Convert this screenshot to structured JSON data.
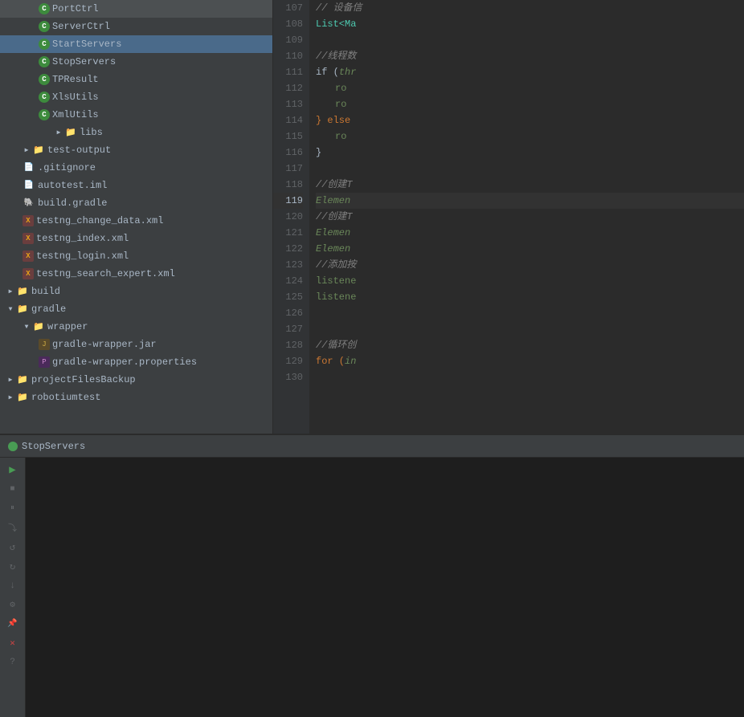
{
  "fileTree": {
    "items": [
      {
        "id": "portctrl",
        "label": "PortCtrl",
        "type": "class",
        "indent": 2,
        "selected": false
      },
      {
        "id": "serverctrl",
        "label": "ServerCtrl",
        "type": "class",
        "indent": 2,
        "selected": false
      },
      {
        "id": "startservers",
        "label": "StartServers",
        "type": "class",
        "indent": 2,
        "selected": true
      },
      {
        "id": "stopservers",
        "label": "StopServers",
        "type": "class",
        "indent": 2,
        "selected": false
      },
      {
        "id": "tpresult",
        "label": "TPResult",
        "type": "class",
        "indent": 2,
        "selected": false
      },
      {
        "id": "xlsutils",
        "label": "XlsUtils",
        "type": "class",
        "indent": 2,
        "selected": false
      },
      {
        "id": "xmlutils",
        "label": "XmlUtils",
        "type": "class",
        "indent": 2,
        "selected": false
      },
      {
        "id": "libs",
        "label": "libs",
        "type": "folder",
        "indent": 3,
        "arrow": "▶",
        "selected": false
      },
      {
        "id": "test-output",
        "label": "test-output",
        "type": "folder",
        "indent": 1,
        "arrow": "▶",
        "selected": false
      },
      {
        "id": "gitignore",
        "label": ".gitignore",
        "type": "file",
        "indent": 1,
        "selected": false
      },
      {
        "id": "autotest-iml",
        "label": "autotest.iml",
        "type": "file",
        "indent": 1,
        "selected": false
      },
      {
        "id": "build-gradle",
        "label": "build.gradle",
        "type": "gradle",
        "indent": 1,
        "selected": false
      },
      {
        "id": "testng-change",
        "label": "testng_change_data.xml",
        "type": "xml",
        "indent": 1,
        "selected": false
      },
      {
        "id": "testng-index",
        "label": "testng_index.xml",
        "type": "xml",
        "indent": 1,
        "selected": false
      },
      {
        "id": "testng-login",
        "label": "testng_login.xml",
        "type": "xml",
        "indent": 1,
        "selected": false
      },
      {
        "id": "testng-search",
        "label": "testng_search_expert.xml",
        "type": "xml",
        "indent": 1,
        "selected": false
      },
      {
        "id": "build",
        "label": "build",
        "type": "folder",
        "indent": 1,
        "arrow": "▶",
        "selected": false
      },
      {
        "id": "gradle",
        "label": "gradle",
        "type": "folder",
        "indent": 1,
        "arrow": "▼",
        "selected": false
      },
      {
        "id": "wrapper",
        "label": "wrapper",
        "type": "folder",
        "indent": 2,
        "arrow": "▼",
        "selected": false
      },
      {
        "id": "gradle-wrapper-jar",
        "label": "gradle-wrapper.jar",
        "type": "jar",
        "indent": 3,
        "selected": false
      },
      {
        "id": "gradle-wrapper-props",
        "label": "gradle-wrapper.properties",
        "type": "props",
        "indent": 3,
        "selected": false
      },
      {
        "id": "projectfilesbackup",
        "label": "projectFilesBackup",
        "type": "folder",
        "indent": 1,
        "arrow": "▶",
        "selected": false
      },
      {
        "id": "robotiumtest",
        "label": "robotiumtest",
        "type": "folder",
        "indent": 1,
        "arrow": "▶",
        "selected": false
      }
    ]
  },
  "codeEditor": {
    "lines": [
      {
        "num": 107,
        "content": "comment",
        "text": "// 设备信"
      },
      {
        "num": 108,
        "content": "code",
        "parts": [
          {
            "type": "cyan",
            "text": "List<Ma"
          }
        ]
      },
      {
        "num": 109,
        "content": "empty",
        "text": ""
      },
      {
        "num": 110,
        "content": "comment",
        "text": "//线程数"
      },
      {
        "num": 111,
        "content": "code",
        "parts": [
          {
            "type": "white",
            "text": "if ("
          },
          {
            "type": "italic-green",
            "text": "thr"
          }
        ]
      },
      {
        "num": 112,
        "content": "code",
        "parts": [
          {
            "type": "green",
            "text": "ro"
          }
        ]
      },
      {
        "num": 113,
        "content": "code",
        "parts": [
          {
            "type": "green",
            "text": "ro"
          }
        ]
      },
      {
        "num": 114,
        "content": "code",
        "parts": [
          {
            "type": "orange",
            "text": "} else"
          }
        ]
      },
      {
        "num": 115,
        "content": "code",
        "parts": [
          {
            "type": "green",
            "text": "ro"
          }
        ]
      },
      {
        "num": 116,
        "content": "code",
        "parts": [
          {
            "type": "white",
            "text": "}"
          }
        ]
      },
      {
        "num": 117,
        "content": "empty",
        "text": ""
      },
      {
        "num": 118,
        "content": "comment",
        "text": "//创建T"
      },
      {
        "num": 119,
        "content": "code_highlight",
        "parts": [
          {
            "type": "italic-green",
            "text": "Elemen"
          }
        ]
      },
      {
        "num": 120,
        "content": "comment",
        "text": "//创建T"
      },
      {
        "num": 121,
        "content": "code",
        "parts": [
          {
            "type": "italic-green",
            "text": "Elemen"
          }
        ]
      },
      {
        "num": 122,
        "content": "code",
        "parts": [
          {
            "type": "italic-green",
            "text": "Elemen"
          }
        ]
      },
      {
        "num": 123,
        "content": "comment",
        "text": "//添加按"
      },
      {
        "num": 124,
        "content": "code",
        "parts": [
          {
            "type": "green",
            "text": "listene"
          }
        ]
      },
      {
        "num": 125,
        "content": "code",
        "parts": [
          {
            "type": "green",
            "text": "listene"
          }
        ]
      },
      {
        "num": 126,
        "content": "empty",
        "text": ""
      },
      {
        "num": 127,
        "content": "empty",
        "text": ""
      },
      {
        "num": 128,
        "content": "comment",
        "text": "//循环创"
      },
      {
        "num": 129,
        "content": "code",
        "parts": [
          {
            "type": "orange",
            "text": "for ("
          },
          {
            "type": "italic-green",
            "text": "in"
          }
        ]
      },
      {
        "num": 130,
        "content": "empty",
        "text": ""
      }
    ]
  },
  "runPanel": {
    "tabLabel": "StopServers",
    "runIconColor": "#499c54",
    "buttons": [
      {
        "id": "play",
        "icon": "▶",
        "active": true,
        "tooltip": "Run"
      },
      {
        "id": "stop",
        "icon": "■",
        "active": false,
        "tooltip": "Stop"
      },
      {
        "id": "pause",
        "icon": "⏸",
        "active": false,
        "tooltip": "Pause"
      },
      {
        "id": "step-over",
        "icon": "⤵",
        "active": false,
        "tooltip": "Step Over"
      },
      {
        "id": "rerun",
        "icon": "↺",
        "active": false,
        "tooltip": "Rerun"
      },
      {
        "id": "rerun-failed",
        "icon": "↻",
        "active": false,
        "tooltip": "Rerun Failed"
      },
      {
        "id": "scroll-end",
        "icon": "↓",
        "active": false,
        "tooltip": "Scroll to End"
      },
      {
        "id": "settings",
        "icon": "⚙",
        "active": false,
        "tooltip": "Settings"
      },
      {
        "id": "pin",
        "icon": "📌",
        "active": false,
        "tooltip": "Pin Tab"
      },
      {
        "id": "close-x",
        "icon": "✕",
        "danger": true,
        "tooltip": "Close"
      },
      {
        "id": "question",
        "icon": "?",
        "active": false,
        "tooltip": "Help"
      }
    ]
  }
}
